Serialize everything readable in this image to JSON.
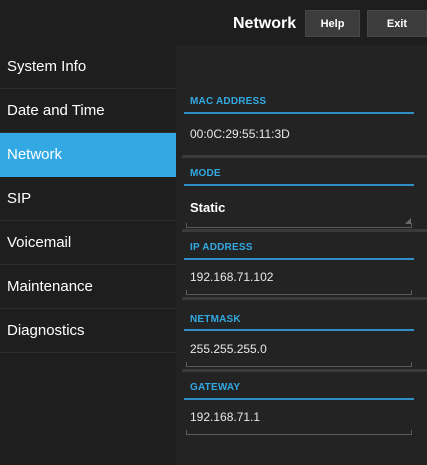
{
  "header": {
    "title": "Network",
    "help_label": "Help",
    "exit_label": "Exit"
  },
  "sidebar": {
    "items": [
      {
        "label": "System Info"
      },
      {
        "label": "Date and Time"
      },
      {
        "label": "Network"
      },
      {
        "label": "SIP"
      },
      {
        "label": "Voicemail"
      },
      {
        "label": "Maintenance"
      },
      {
        "label": "Diagnostics"
      }
    ],
    "active_label": "Network"
  },
  "fields": {
    "mac": {
      "label": "MAC ADDRESS",
      "value": "00:0C:29:55:11:3D"
    },
    "mode": {
      "label": "MODE",
      "value": "Static"
    },
    "ip": {
      "label": "IP ADDRESS",
      "value": "192.168.71.102"
    },
    "netmask": {
      "label": "NETMASK",
      "value": "255.255.255.0"
    },
    "gateway": {
      "label": "GATEWAY",
      "value": "192.168.71.1"
    }
  },
  "colors": {
    "accent": "#33a9e3",
    "background": "#1e1e1e"
  }
}
